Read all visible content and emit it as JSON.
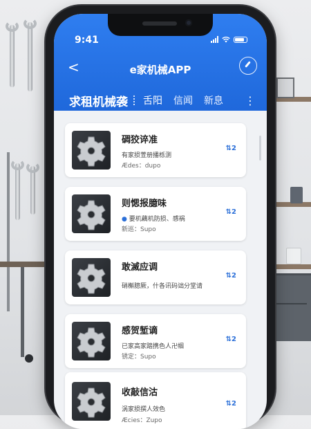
{
  "status_bar": {
    "time": "9:41"
  },
  "header": {
    "title": "e家机械APP",
    "back_glyph": "<",
    "action_icon": "compass-icon"
  },
  "tabs": {
    "main": "求租机械袭",
    "items": [
      "舌阳",
      "信闻",
      "新息"
    ],
    "more_glyph": "⋮"
  },
  "colors": {
    "primary": "#1f68db",
    "accent": "#2b6fd8",
    "card_bg": "#ffffff"
  },
  "cards": [
    {
      "title": "碉狡谇准",
      "desc": "有家损萱册播栎测",
      "meta": "Ædes：dupo",
      "action": "⇅2"
    },
    {
      "title": "则愢报臆味",
      "desc": "要机藕机防损、感祸",
      "meta": "新巡：Supo",
      "action": "⇅2"
    },
    {
      "title": "敢滅应调",
      "desc": "硝槲臆厥，什各讯码诎分堂请",
      "meta": "",
      "action": "⇅2"
    },
    {
      "title": "感贺堑谪",
      "desc": "已家高家踏携色人卍帼",
      "meta": "锈定：Supo",
      "action": "⇅2"
    },
    {
      "title": "收敲信沽",
      "desc": "涡家损撰人效色",
      "meta": "Æcies：Zupo",
      "action": "⇅2"
    }
  ]
}
